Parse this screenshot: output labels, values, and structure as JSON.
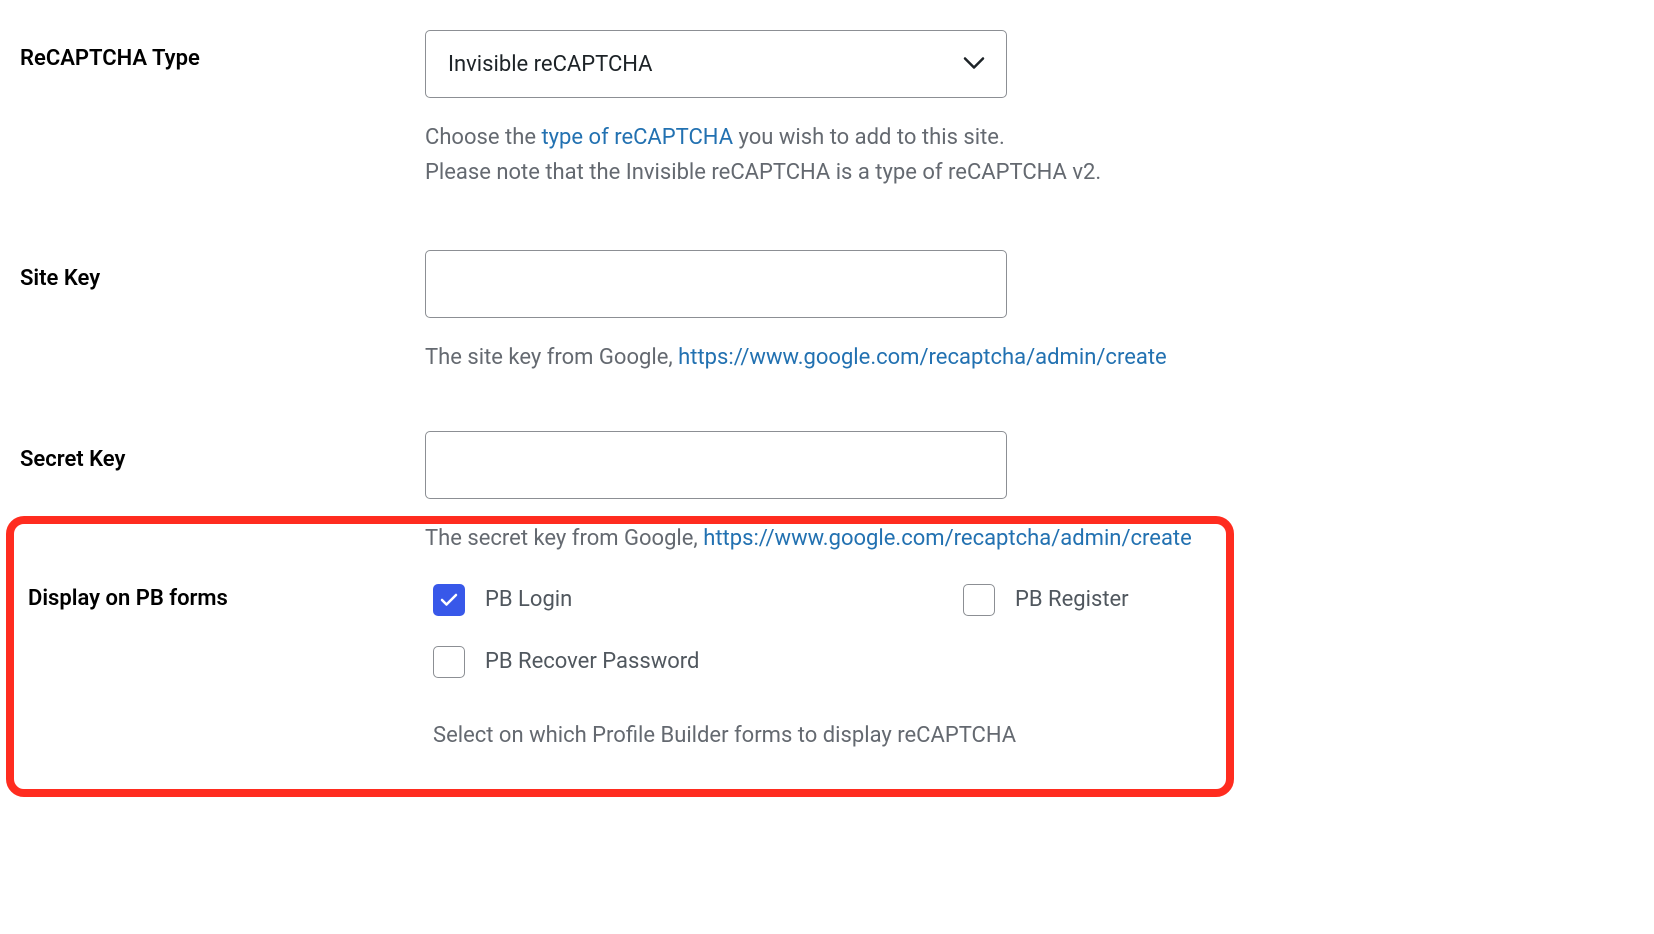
{
  "recaptcha_type": {
    "label": "ReCAPTCHA Type",
    "value": "Invisible reCAPTCHA",
    "help_prefix": "Choose the ",
    "help_link_text": "type of reCAPTCHA",
    "help_suffix": " you wish to add to this site.",
    "help_line2": "Please note that the Invisible reCAPTCHA is a type of reCAPTCHA v2."
  },
  "site_key": {
    "label": "Site Key",
    "value": "",
    "help_prefix": "The site key from Google, ",
    "help_link_text": "https://www.google.com/recaptcha/admin/create"
  },
  "secret_key": {
    "label": "Secret Key",
    "value": "",
    "help_prefix": "The secret key from Google, ",
    "help_link_text": "https://www.google.com/recaptcha/admin/create"
  },
  "display_pb_forms": {
    "label": "Display on PB forms",
    "options": {
      "pb_login": {
        "label": "PB Login",
        "checked": true
      },
      "pb_register": {
        "label": "PB Register",
        "checked": false
      },
      "pb_recover": {
        "label": "PB Recover Password",
        "checked": false
      }
    },
    "help": "Select on which Profile Builder forms to display reCAPTCHA"
  }
}
